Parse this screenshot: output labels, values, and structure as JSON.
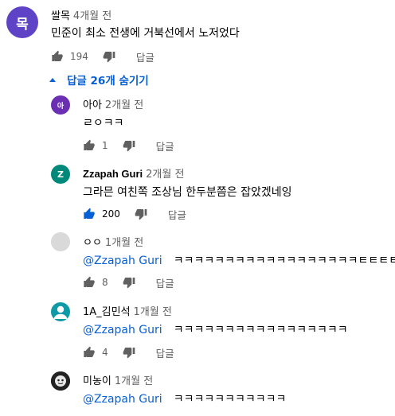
{
  "top_comment": {
    "avatar_initial": "목",
    "avatar_color": "#5f43c6",
    "author": "쌀목",
    "time": "4개월 전",
    "text": "민준이 최소 전생에 거북선에서 노저었다",
    "likes": "194",
    "reply_label": "답글"
  },
  "replies_toggle": {
    "label": "답글 26개 숨기기",
    "accent_color": "#065fd4"
  },
  "replies": [
    {
      "avatar_initial": "아",
      "avatar_color": "#6b2fb3",
      "author": "아아",
      "time": "2개월 전",
      "mention": "",
      "text": "ㄹㅇㅋㅋ",
      "likes": "1",
      "liked": false,
      "reply_label": "답글"
    },
    {
      "avatar_initial": "Z",
      "avatar_color": "#00897b",
      "author": "Zzapah Guri",
      "time": "2개월 전",
      "mention": "",
      "text": "그라믄 여친쪽 조상님 한두분쯤은 잡았겠네잉",
      "likes": "200",
      "liked": true,
      "reply_label": "답글"
    },
    {
      "avatar_initial": "",
      "avatar_color": "#d9d9d9",
      "author": "ㅇㅇ",
      "time": "1개월 전",
      "mention": "@Zzapah Guri",
      "text": "ㅋㅋㅋㅋㅋㅋㅋㅋㅋㅋㅋㅋㅋㅋㅋㅋㅋㅋㅌㅌㅌㅌ",
      "likes": "8",
      "liked": false,
      "reply_label": "답글"
    },
    {
      "avatar_initial": "",
      "avatar_color": "#0f9aa8",
      "author": "1A_김민석",
      "time": "1개월 전",
      "mention": "@Zzapah Guri",
      "text": "ㅋㅋㅋㅋㅋㅋㅋㅋㅋㅋㅋㅋㅋㅋㅋㅋㅋ",
      "likes": "4",
      "liked": false,
      "reply_label": "답글"
    },
    {
      "avatar_initial": "",
      "avatar_color": "#222222",
      "author": "미농이",
      "time": "1개월 전",
      "mention": "@Zzapah Guri",
      "text": "ㅋㅋㅋㅋㅋㅋㅋㅋㅋㅋㅋ",
      "likes": "",
      "liked": false,
      "reply_label": ""
    }
  ]
}
